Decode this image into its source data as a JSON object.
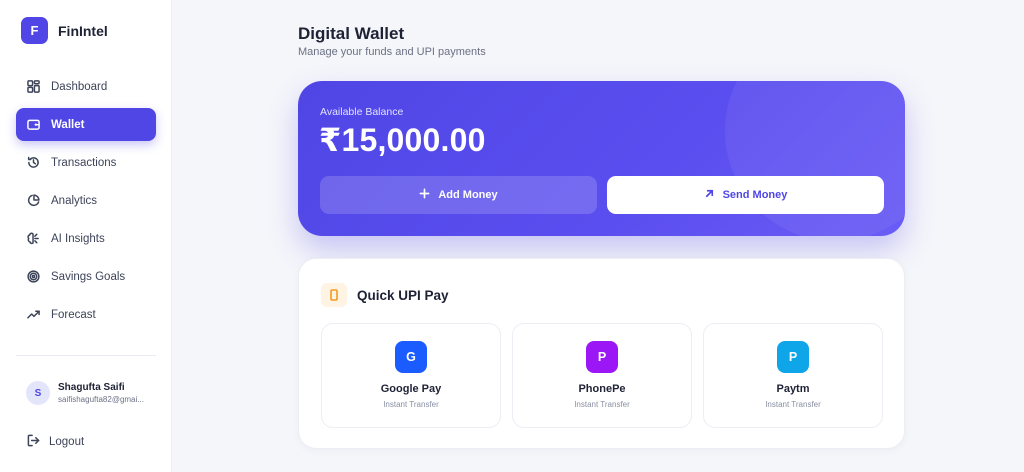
{
  "brand": {
    "logo_letter": "F",
    "name": "FinIntel"
  },
  "nav": {
    "items": [
      {
        "label": "Dashboard",
        "icon": "dashboard-icon"
      },
      {
        "label": "Wallet",
        "icon": "wallet-icon"
      },
      {
        "label": "Transactions",
        "icon": "history-icon"
      },
      {
        "label": "Analytics",
        "icon": "pie-chart-icon"
      },
      {
        "label": "AI Insights",
        "icon": "brain-icon"
      },
      {
        "label": "Savings Goals",
        "icon": "target-icon"
      },
      {
        "label": "Forecast",
        "icon": "trending-up-icon"
      }
    ],
    "active": "Wallet"
  },
  "user": {
    "initial": "S",
    "name": "Shagufta Saifi",
    "email": "saifishagufta82@gmai..."
  },
  "logout_label": "Logout",
  "page": {
    "title": "Digital Wallet",
    "subtitle": "Manage your funds and UPI payments"
  },
  "balance": {
    "label": "Available Balance",
    "amount": "₹15,000.00",
    "add_label": "Add Money",
    "send_label": "Send Money"
  },
  "upi": {
    "title": "Quick UPI Pay",
    "apps": [
      {
        "letter": "G",
        "name": "Google Pay",
        "sub": "Instant Transfer",
        "color": "#1a5cff"
      },
      {
        "letter": "P",
        "name": "PhonePe",
        "sub": "Instant Transfer",
        "color": "#9b17f5"
      },
      {
        "letter": "P",
        "name": "Paytm",
        "sub": "Instant Transfer",
        "color": "#0ea5e9"
      }
    ]
  },
  "colors": {
    "accent": "#4f46e5",
    "background": "#f5f6fa",
    "upi_icon": "#f39a1d"
  }
}
